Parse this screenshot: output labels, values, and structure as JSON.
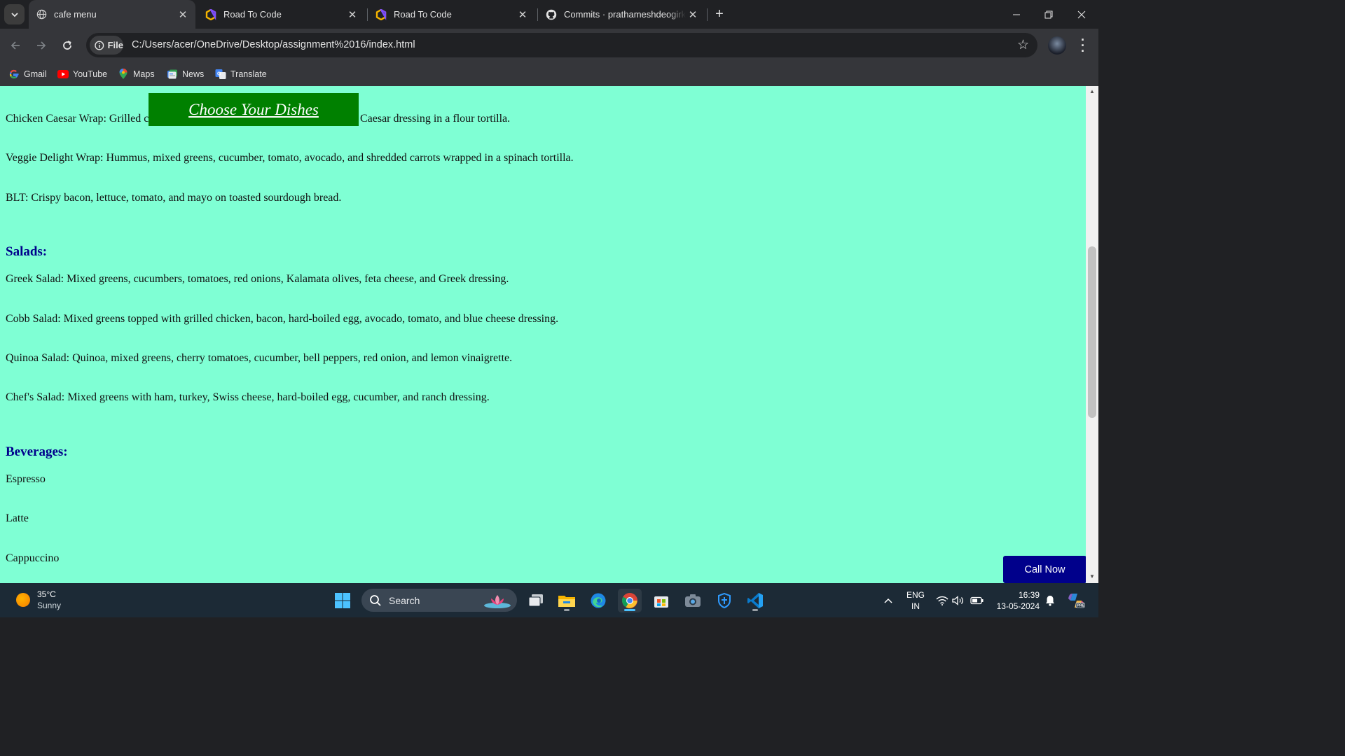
{
  "browser": {
    "tabs": [
      {
        "title": "cafe menu",
        "active": true
      },
      {
        "title": "Road To Code",
        "active": false
      },
      {
        "title": "Road To Code",
        "active": false
      },
      {
        "title": "Commits · prathameshdeogirkar",
        "active": false
      }
    ],
    "address": {
      "chip_label": "File",
      "url": "C:/Users/acer/OneDrive/Desktop/assignment%2016/index.html"
    },
    "bookmarks": [
      {
        "label": "Gmail",
        "icon": "google-icon"
      },
      {
        "label": "YouTube",
        "icon": "youtube-icon"
      },
      {
        "label": "Maps",
        "icon": "maps-icon"
      },
      {
        "label": "News",
        "icon": "news-icon"
      },
      {
        "label": "Translate",
        "icon": "translate-icon"
      }
    ]
  },
  "page": {
    "background_color": "#7fffd4",
    "banner_label": "Choose Your Dishes",
    "banner_color": "#008000",
    "sandwich_items": [
      "Chicken Caesar Wrap: Grilled chicken, romaine lettuce, Parmesan cheese, and Caesar dressing in a flour tortilla.",
      "Veggie Delight Wrap: Hummus, mixed greens, cucumber, tomato, avocado, and shredded carrots wrapped in a spinach tortilla.",
      "BLT: Crispy bacon, lettuce, tomato, and mayo on toasted sourdough bread."
    ],
    "salads_heading": "Salads:",
    "salad_items": [
      "Greek Salad: Mixed greens, cucumbers, tomatoes, red onions, Kalamata olives, feta cheese, and Greek dressing.",
      "Cobb Salad: Mixed greens topped with grilled chicken, bacon, hard-boiled egg, avocado, tomato, and blue cheese dressing.",
      "Quinoa Salad: Quinoa, mixed greens, cherry tomatoes, cucumber, bell peppers, red onion, and lemon vinaigrette.",
      "Chef's Salad: Mixed greens with ham, turkey, Swiss cheese, hard-boiled egg, cucumber, and ranch dressing."
    ],
    "beverages_heading": "Beverages:",
    "beverage_items": [
      "Espresso",
      "Latte",
      "Cappuccino"
    ],
    "call_now_label": "Call Now",
    "heading_color": "#00008b"
  },
  "taskbar": {
    "weather_temp": "35°C",
    "weather_desc": "Sunny",
    "search_label": "Search",
    "lang_line1": "ENG",
    "lang_line2": "IN",
    "time": "16:39",
    "date": "13-05-2024",
    "pinned": [
      "windows-start-icon",
      "task-view-icon",
      "file-explorer-icon",
      "edge-icon",
      "chrome-icon",
      "microsoft-store-icon",
      "camera-icon",
      "defender-icon",
      "vscode-icon"
    ]
  }
}
